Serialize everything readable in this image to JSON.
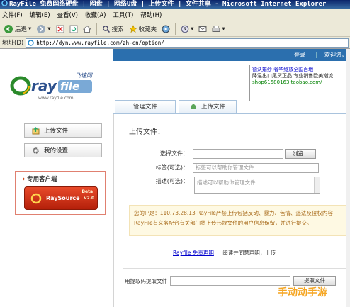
{
  "window": {
    "title": "RayFile 免费网络硬盘 | 网盘 | 网络U盘 | 上传文件 | 文件共享 - Microsoft Internet Explorer"
  },
  "menu": {
    "items": [
      "文件(F)",
      "编辑(E)",
      "查看(V)",
      "收藏(A)",
      "工具(T)",
      "帮助(H)"
    ]
  },
  "toolbar": {
    "back": "后退",
    "search": "搜索",
    "favorites": "收藏夹"
  },
  "address": {
    "label": "地址(D)",
    "url": "http://dyn.www.rayfile.com/zh-cn/option/"
  },
  "topstrip": {
    "login": "登录",
    "sep": "|",
    "welcome": "欢迎您，zh"
  },
  "logo": {
    "brand": "rayfile",
    "cn": "飞速网",
    "url": "www.rayfile.com"
  },
  "ad": {
    "line1": "德沃婚纱  奢华绽放全国百地",
    "line2": "降温出口尾货正品 专业销售欧美潮流",
    "line3": "shop61580163.taobao.com/"
  },
  "tabs": {
    "manage": "管理文件",
    "upload": "上传文件"
  },
  "leftnav": {
    "upload_btn": "上传文件",
    "settings_btn": "我的设置",
    "client_header": "专用客户端",
    "client_name": "RaySource",
    "client_ver": "v2.0",
    "client_tag": "Beta"
  },
  "form": {
    "title": "上传文件：",
    "choose_label": "选择文件：",
    "browse": "浏览...",
    "tag_label": "标签(可选)：",
    "tag_placeholder": "标签可以帮助你管理文件",
    "desc_label": "描述(可选)：",
    "desc_placeholder": "描述可以帮助你管理文件"
  },
  "notice": {
    "line1": "您的IP是：110.73.28.13 RayFile严禁上传包括反动、暴力、色情、违法及侵权内容",
    "line2": "RayFile有义务配合有关部门将上传违规文件的用户信息保留，并进行提交。"
  },
  "agree": {
    "link": "Rayfile 免责声明",
    "text": "阅读并同意声明，上传"
  },
  "extract": {
    "label": "用提取码提取文件",
    "button": "提取文件"
  },
  "watermark": "手动动手游"
}
